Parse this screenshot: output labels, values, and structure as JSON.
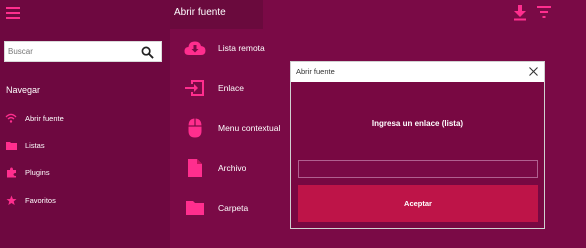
{
  "colors": {
    "accent": "#ff2e8e",
    "background": "#7a0a46",
    "sidebar": "#6e0840",
    "button": "#be1448"
  },
  "header": {
    "title": "Abrir fuente"
  },
  "sidebar": {
    "search": {
      "placeholder": "Buscar"
    },
    "nav_title": "Navegar",
    "items": [
      {
        "label": "Abrir fuente",
        "icon": "wifi-icon"
      },
      {
        "label": "Listas",
        "icon": "folder-icon"
      },
      {
        "label": "Plugins",
        "icon": "puzzle-icon"
      },
      {
        "label": "Favoritos",
        "icon": "star-icon"
      }
    ]
  },
  "main": {
    "sources": [
      {
        "label": "Lista remota",
        "icon": "cloud-download-icon"
      },
      {
        "label": "Enlace",
        "icon": "login-icon"
      },
      {
        "label": "Menu contextual",
        "icon": "mouse-icon"
      },
      {
        "label": "Archivo",
        "icon": "file-icon"
      },
      {
        "label": "Carpeta",
        "icon": "folder-icon"
      }
    ]
  },
  "dialog": {
    "title": "Abrir fuente",
    "prompt": "Ingresa un enlace (lista)",
    "input_value": "",
    "accept_label": "Aceptar"
  }
}
